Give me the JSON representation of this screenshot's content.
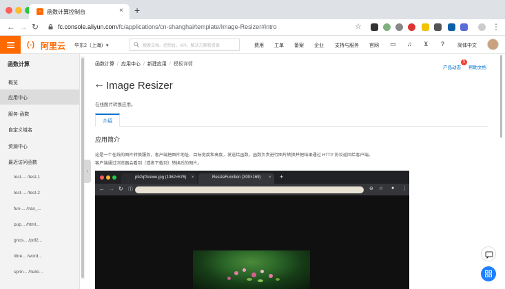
{
  "browser": {
    "tab_title": "函数计算控制台",
    "url_host": "fc.console.aliyun.com",
    "url_path": "/fc/applications/cn-shanghai/template/Image-Resizer#intro"
  },
  "header": {
    "logo_mark": "(-)",
    "logo_text": "阿里云",
    "region": "华东2（上海）▾",
    "search_placeholder": "搜索文档、控制台、API、解决方案和资源",
    "nav": [
      "费用",
      "工单",
      "备案",
      "企业",
      "支持与服务",
      "官网"
    ],
    "language": "简体中文"
  },
  "sidebar": {
    "title": "函数计算",
    "items": [
      "概览",
      "应用中心",
      "服务-函数",
      "自定义域名",
      "资源中心",
      "最近访问函数"
    ],
    "active_index": 1,
    "recent": [
      "test-... /test-1",
      "test-... /test-2",
      "fun-... /nas_...",
      "pup... /html...",
      "gnos... /pdf2...",
      "libre... /word...",
      "sprin... /hello..."
    ]
  },
  "main": {
    "breadcrumb": [
      "函数计算",
      "应用中心",
      "新建应用",
      "模板详情"
    ],
    "product_news": "产品动态",
    "news_badge": "5",
    "help_docs": "帮助文档",
    "title": "Image Resizer",
    "subtitle": "在线图片转换应用。",
    "tab_intro": "介绍",
    "section_title": "应用简介",
    "desc_line1": "这是一个在线的图片转换服务，客户端把图片地址、目标宽度和高度，发送给函数，函数负责进行图片转换并把结果通过 HTTP 协议返回给客户端。",
    "desc_line2": "客户端通过浏览器会看到（或者下载到）转换后的图片。"
  },
  "embedded_screenshot": {
    "tab1": "pb2qf3cewu.jpg (1362×676)",
    "tab2": "ResizeFunction (300×169)"
  }
}
